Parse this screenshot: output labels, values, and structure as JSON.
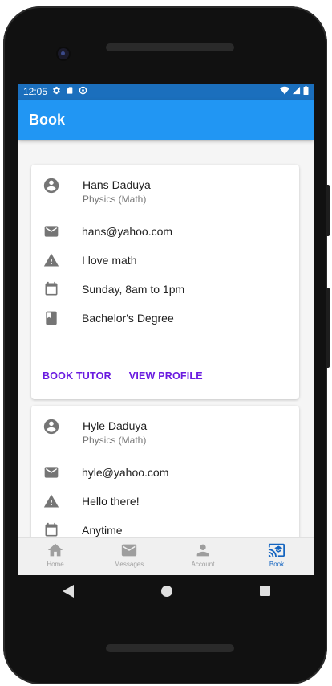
{
  "status_bar": {
    "time": "12:05"
  },
  "app_bar": {
    "title": "Book"
  },
  "tutors": [
    {
      "name": "Hans Daduya",
      "subject": "Physics (Math)",
      "email": "hans@yahoo.com",
      "bio": "I love math",
      "schedule": "Sunday, 8am to 1pm",
      "degree": "Bachelor's Degree",
      "book_label": "BOOK TUTOR",
      "profile_label": "VIEW PROFILE"
    },
    {
      "name": "Hyle Daduya",
      "subject": "Physics (Math)",
      "email": "hyle@yahoo.com",
      "bio": "Hello there!",
      "schedule": "Anytime"
    }
  ],
  "bottom_nav": {
    "items": [
      {
        "label": "Home",
        "icon": "home-icon"
      },
      {
        "label": "Messages",
        "icon": "mail-icon"
      },
      {
        "label": "Account",
        "icon": "person-icon"
      },
      {
        "label": "Book",
        "icon": "cast-for-education-icon"
      }
    ],
    "active": "Book"
  },
  "colors": {
    "status_bar": "#1b6fbd",
    "app_bar": "#2196f3",
    "action_text": "#6a1be0",
    "nav_active": "#1565c0"
  }
}
